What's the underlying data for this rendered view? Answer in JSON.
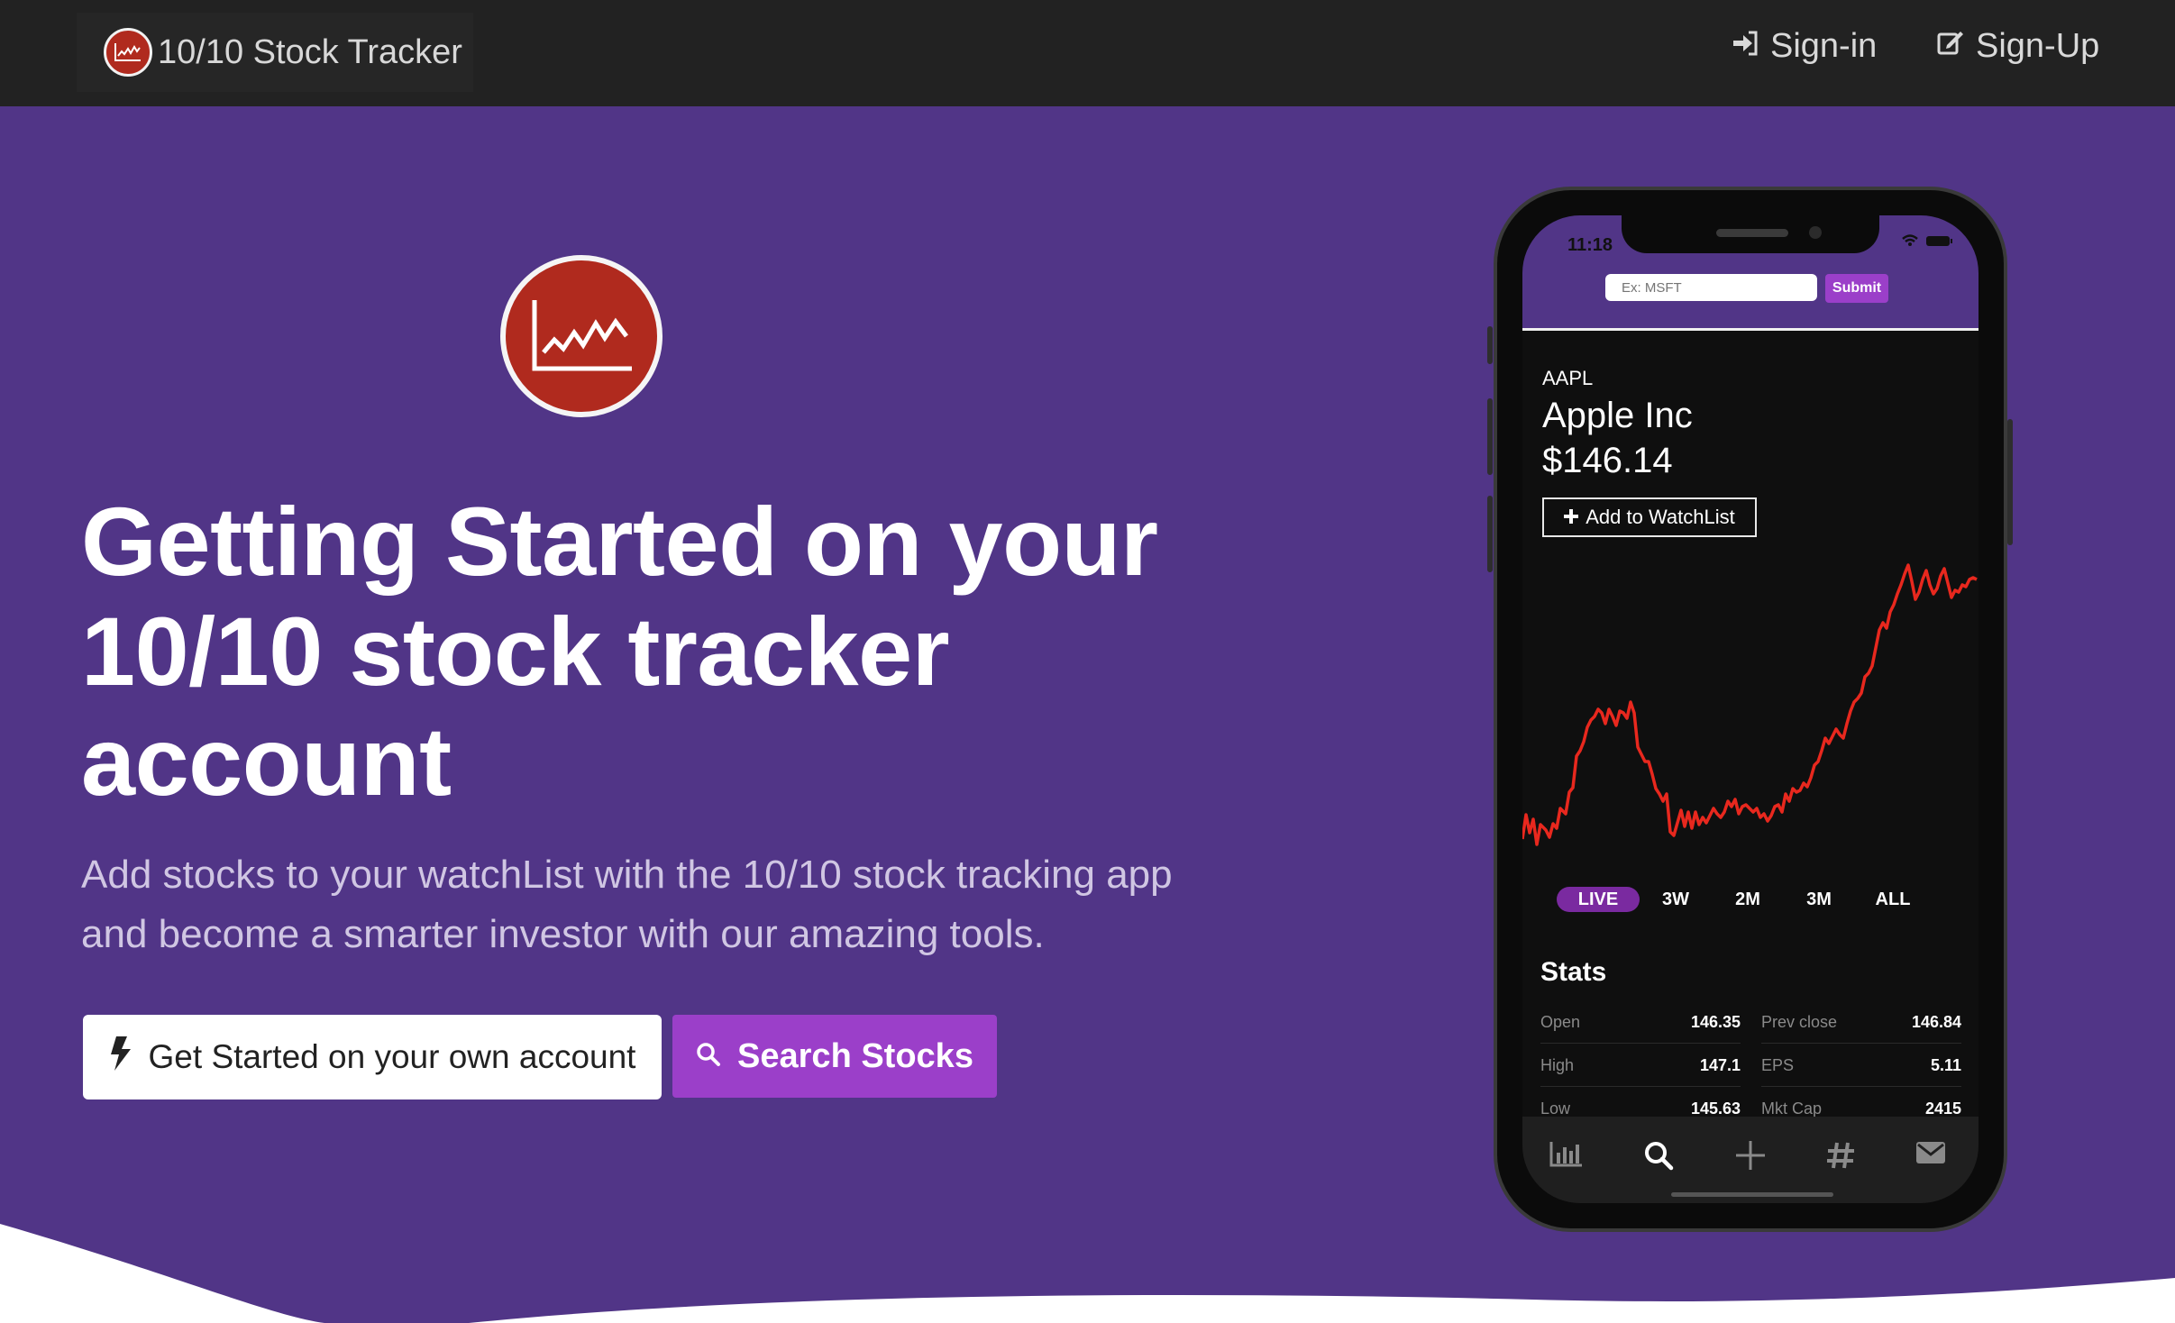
{
  "nav": {
    "brand": "10/10 Stock Tracker",
    "signin": "Sign-in",
    "signup": "Sign-Up"
  },
  "hero": {
    "headline": "Getting Started on your 10/10 stock tracker account",
    "subtext": "Add stocks to your watchList with the 10/10 stock tracking app and become a smarter investor with our amazing tools.",
    "primary_button": "Get Started on your own account",
    "search_button": "Search Stocks"
  },
  "phone": {
    "time": "11:18",
    "search_placeholder": "Ex: MSFT",
    "submit_label": "Submit",
    "symbol": "AAPL",
    "company": "Apple Inc",
    "price": "$146.14",
    "watchlist_button": "Add to WatchList",
    "ranges": [
      "LIVE",
      "3W",
      "2M",
      "3M",
      "ALL"
    ],
    "active_range": "LIVE",
    "stats_title": "Stats",
    "stats": [
      {
        "label": "Open",
        "value": "146.35"
      },
      {
        "label": "Prev close",
        "value": "146.84"
      },
      {
        "label": "High",
        "value": "147.1"
      },
      {
        "label": "EPS",
        "value": "5.11"
      },
      {
        "label": "Low",
        "value": "145.63"
      },
      {
        "label": "Mkt Cap",
        "value": "2415"
      }
    ],
    "tabs": [
      "bar-chart-icon",
      "search-icon",
      "plus-icon",
      "hashtag-icon",
      "mail-icon"
    ],
    "line_color": "#e8281e"
  },
  "colors": {
    "background": "#513587",
    "navbar": "#222222",
    "accent": "#9b3fc9",
    "logo_red": "#b02a1e"
  }
}
